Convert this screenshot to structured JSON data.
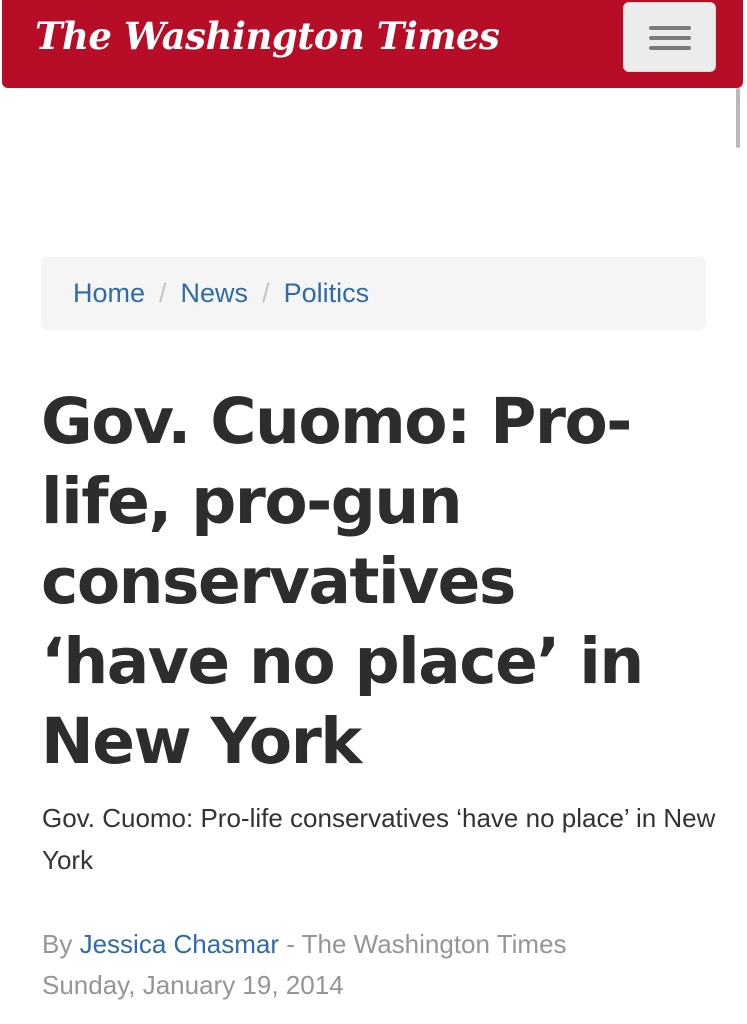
{
  "header": {
    "logo_text": "The Washington Times",
    "brand_color": "#b70d26",
    "menu_icon": "hamburger-menu-icon"
  },
  "breadcrumb": {
    "items": [
      {
        "label": "Home"
      },
      {
        "label": "News"
      },
      {
        "label": "Politics"
      }
    ],
    "separator": "/"
  },
  "article": {
    "headline": "Gov. Cuomo: Pro-life, pro-gun conservatives ‘have no place’ in New York",
    "subheadline": "Gov. Cuomo: Pro-life conservatives ‘have no place’ in New York",
    "byline_prefix": "By ",
    "author": "Jessica Chasmar",
    "byline_suffix": " - The Washington Times",
    "date": "Sunday, January 19, 2014"
  }
}
